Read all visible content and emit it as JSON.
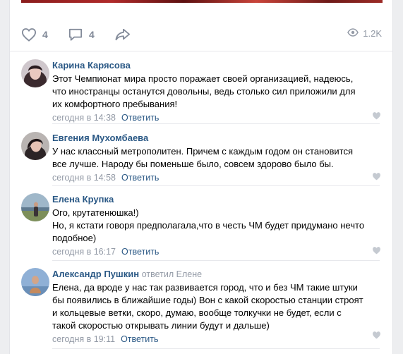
{
  "post": {
    "likes": "4",
    "comments": "4",
    "views": "1.2K"
  },
  "icons": {
    "like": "heart-outline-icon",
    "comment": "speech-bubble-icon",
    "share": "share-arrow-icon",
    "views": "eye-icon",
    "comment_like": "heart-icon"
  },
  "colors": {
    "author": "#2a5885",
    "muted": "#939aa6",
    "icon": "#828a99",
    "divider": "#e7e8ec"
  },
  "comments": [
    {
      "author": "Карина Карясова",
      "replied_to": "",
      "lines": [
        "Этот Чемпионат мира просто поражает своей организацией, надеюсь,",
        "что иностранцы останутся довольны, ведь столько сил приложили для",
        "их комфортного пребывания!"
      ],
      "time": "сегодня в 14:38",
      "reply_label": "Ответить"
    },
    {
      "author": "Евгения Мухомбаева",
      "replied_to": "",
      "lines": [
        "У нас классный метрополитен. Причем с каждым годом он становится",
        "все лучше. Народу бы поменьше было, совсем здорово было бы."
      ],
      "time": "сегодня в 14:58",
      "reply_label": "Ответить"
    },
    {
      "author": "Елена Крупка",
      "replied_to": "",
      "lines": [
        "Ого, крутатенюшка!)",
        "Но, я кстати говоря предполагала,что в честь ЧМ будет придумано нечто",
        "подобное)"
      ],
      "time": "сегодня в 16:17",
      "reply_label": "Ответить"
    },
    {
      "author": "Александр Пушкин",
      "replied_to": "ответил Елене",
      "lines": [
        "Елена, да вроде у нас так развивается город, что и без ЧМ такие штуки",
        "бы появились в ближайшие годы) Вон с какой скоростью станции строят",
        "и кольцевые ветки, скоро, думаю, вообще толкучки не будет, если с",
        "такой скоростью открывать линии будут и дальше)"
      ],
      "time": "сегодня в 19:11",
      "reply_label": "Ответить"
    }
  ]
}
